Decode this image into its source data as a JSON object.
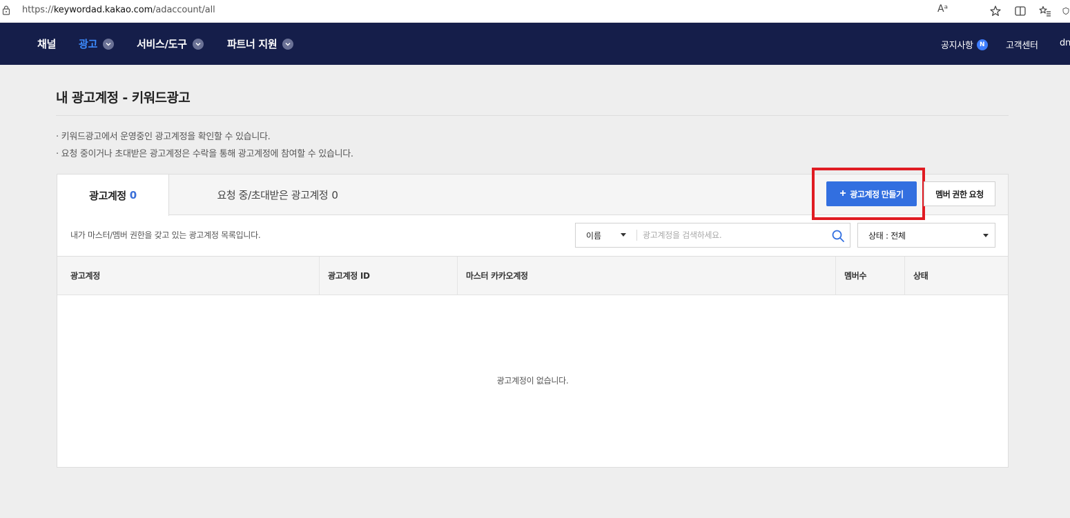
{
  "browser": {
    "url_prefix": "https://",
    "url_host": "keywordad.kakao.com",
    "url_path": "/adaccount/all",
    "read_aloud": "Aᵃ"
  },
  "nav": {
    "items": [
      {
        "label": "채널",
        "active": false,
        "has_caret": false
      },
      {
        "label": "광고",
        "active": true,
        "has_caret": true
      },
      {
        "label": "서비스/도구",
        "active": false,
        "has_caret": true
      },
      {
        "label": "파트너 지원",
        "active": false,
        "has_caret": true
      }
    ],
    "notice_label": "공지사항",
    "notice_badge": "N",
    "support_label": "고객센터",
    "user_label": "dn"
  },
  "page": {
    "title": "내 광고계정 - 키워드광고",
    "descriptions": [
      "· 키워드광고에서 운영중인 광고계정을 확인할 수 있습니다.",
      "· 요청 중이거나 초대받은 광고계정은 수락을 통해 광고계정에 참여할 수 있습니다."
    ]
  },
  "tabs": [
    {
      "label": "광고계정",
      "count": "0",
      "active": true
    },
    {
      "label": "요청 중/초대받은 광고계정",
      "count": "0",
      "active": false
    }
  ],
  "actions": {
    "create_label": "광고계정 만들기",
    "member_request_label": "멤버 권한 요청"
  },
  "list_info": "내가 마스터/멤버 권한을 갖고 있는 광고계정 목록입니다.",
  "search": {
    "field_selected": "이름",
    "placeholder": "광고계정을 검색하세요.",
    "value": ""
  },
  "status_filter": {
    "selected": "상태 : 전체"
  },
  "table": {
    "columns": [
      "광고계정",
      "광고계정 ID",
      "마스터 카카오계정",
      "멤버수",
      "상태"
    ],
    "rows": [],
    "empty_message": "광고계정이 없습니다."
  },
  "colors": {
    "nav_bg": "#151e4a",
    "accent": "#326fe0",
    "highlight": "#e01b22"
  }
}
